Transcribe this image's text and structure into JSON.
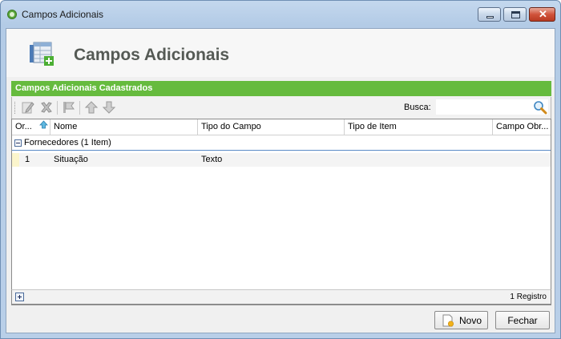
{
  "window": {
    "title": "Campos Adicionais",
    "icons": {
      "app": "app-logo-icon",
      "minimize": "minimize-icon",
      "maximize": "maximize-icon",
      "close": "close-icon"
    }
  },
  "header": {
    "title": "Campos Adicionais",
    "icon": "table-add-icon"
  },
  "section": {
    "title": "Campos Adicionais Cadastrados"
  },
  "toolbar": {
    "buttons": [
      "edit-icon",
      "delete-icon",
      "clone-icon",
      "move-up-icon",
      "move-down-icon"
    ],
    "search_label": "Busca:",
    "search_value": "",
    "search_icon": "magnifier-icon"
  },
  "grid": {
    "columns": [
      "Or...",
      "Nome",
      "Tipo do Campo",
      "Tipo de Item",
      "Campo Obr..."
    ],
    "sort_icon": "sort-ascending-icon",
    "groups": [
      {
        "label": "Fornecedores (1 Item)",
        "rows": [
          {
            "ordem": "1",
            "nome": "Situação",
            "tipo_campo": "Texto",
            "tipo_item": "",
            "obrigatorio": ""
          }
        ]
      }
    ],
    "footer": {
      "count": "1 Registro",
      "expand_icon": "plus-icon"
    }
  },
  "buttons": {
    "novo": "Novo",
    "fechar": "Fechar"
  },
  "colors": {
    "accent_green": "#66bb3e",
    "title_gray": "#555a55"
  }
}
